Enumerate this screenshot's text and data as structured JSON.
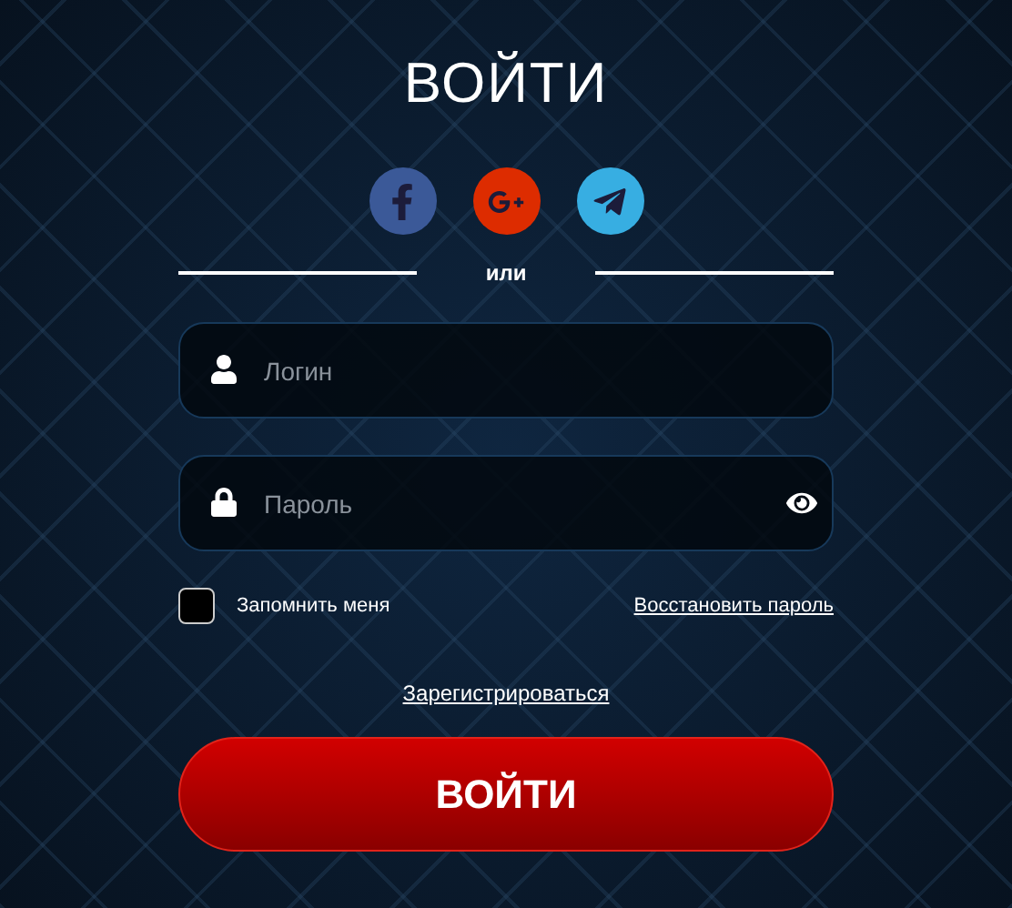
{
  "title": "ВОЙТИ",
  "social": [
    {
      "kind": "facebook",
      "color": "#3b5998"
    },
    {
      "kind": "google",
      "color": "#dd2c00"
    },
    {
      "kind": "telegram",
      "color": "#37aee2"
    }
  ],
  "divider_text": "или",
  "fields": [
    {
      "kind": "login",
      "placeholder": "Логин"
    },
    {
      "kind": "password",
      "placeholder": "Пароль"
    }
  ],
  "remember": {
    "label": "Запомнить меня",
    "checked": false
  },
  "restore_link": "Восстановить пароль",
  "register_link": "Зарегистрироваться",
  "submit": "ВОЙТИ"
}
